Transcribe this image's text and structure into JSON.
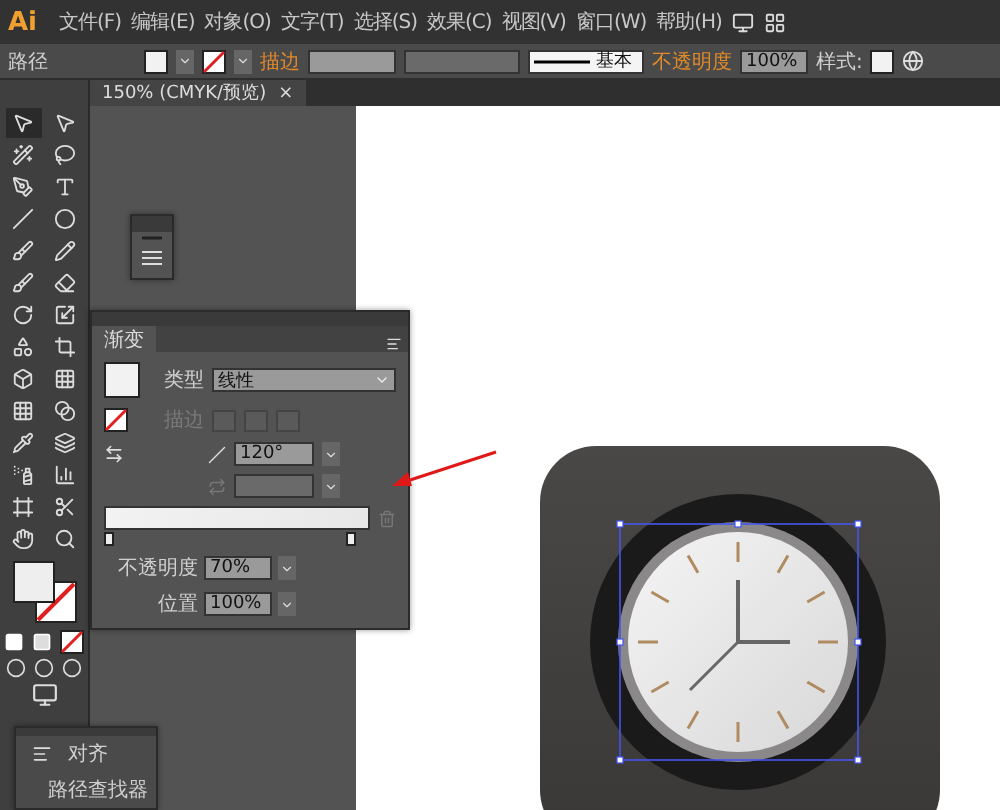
{
  "menu_bar": {
    "logo": "Ai",
    "items": [
      "文件(F)",
      "编辑(E)",
      "对象(O)",
      "文字(T)",
      "选择(S)",
      "效果(C)",
      "视图(V)",
      "窗口(W)",
      "帮助(H)"
    ]
  },
  "control_bar": {
    "object_type": "路径",
    "stroke_label": "描边",
    "stroke_profile": "基本",
    "opacity_label": "不透明度",
    "opacity_value": "100%",
    "style_label": "样式:"
  },
  "document_tab": {
    "title": "150% (CMYK/预览)",
    "close": "×"
  },
  "gradient_panel": {
    "tab": "渐变",
    "type_label": "类型",
    "type_value": "线性",
    "stroke_label": "描边",
    "angle_value": "120°",
    "opacity_label": "不透明度",
    "opacity_value": "70%",
    "location_label": "位置",
    "location_value": "100%"
  },
  "bottom_panel": {
    "items": [
      {
        "label": "对齐"
      },
      {
        "label": "路径查找器"
      }
    ]
  }
}
